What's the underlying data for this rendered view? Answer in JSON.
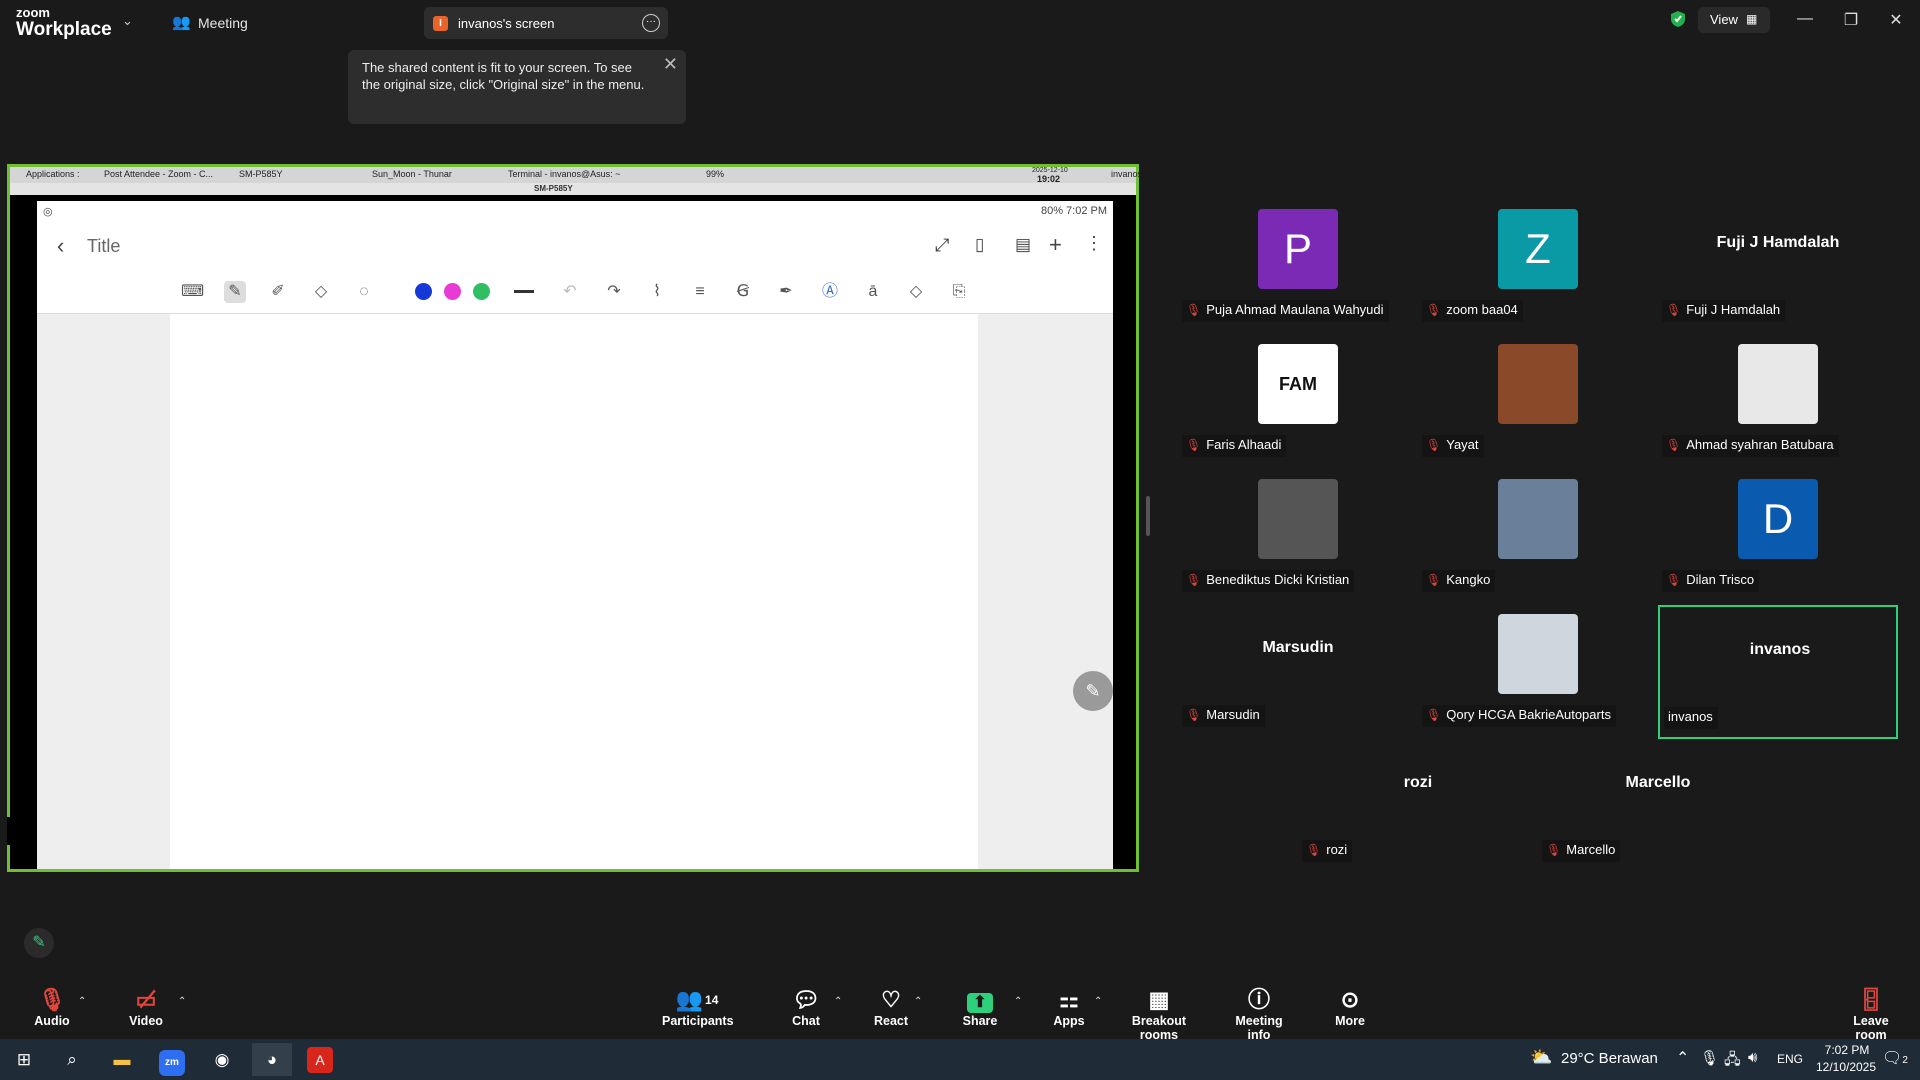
{
  "titlebar": {
    "logo_small": "zoom",
    "logo_big": "Workplace",
    "meeting_label": "Meeting",
    "share_tab_initial": "I",
    "share_tab_label": "invanos's screen",
    "view_label": "View"
  },
  "tooltip": {
    "text": "The shared content is fit to your screen. To see the original size, click \"Original size\" in the menu."
  },
  "shared": {
    "taskbar": [
      "Applications :",
      "Post Attendee - Zoom - C...",
      "SM-P585Y",
      "Sun_Moon - Thunar",
      "Terminal - invanos@Asus: ~"
    ],
    "battery_pct": "99%",
    "date": "2025-12-10",
    "time": "19:02",
    "user": "invanos",
    "window_title": "SM-P585Y",
    "phone_status": "80%  7:02 PM",
    "note_title": "Title",
    "colors": [
      "#1539d6",
      "#e83bd6",
      "#2fbf62"
    ]
  },
  "participants": [
    {
      "name": "Puja Ahmad Maulana Wahyudi",
      "avatar": "P",
      "color": "#7b2ab5"
    },
    {
      "name": "zoom baa04",
      "avatar": "Z",
      "color": "#0a9aa6"
    },
    {
      "name": "Fuji J Hamdalah",
      "big": "Fuji J Hamdalah"
    },
    {
      "name": "Faris Alhaadi",
      "avatar": "FAM",
      "color": "#ffffff"
    },
    {
      "name": "Yayat",
      "avatar": "photo",
      "color": "#8a4a2a"
    },
    {
      "name": "Ahmad syahran Batubara",
      "avatar": "photo",
      "color": "#e8e8e8"
    },
    {
      "name": "Benediktus Dicki Kristian",
      "avatar": "photo",
      "color": "#555555"
    },
    {
      "name": "Kangko",
      "avatar": "photo",
      "color": "#6a7f9a"
    },
    {
      "name": "Dilan Trisco",
      "avatar": "D",
      "color": "#0a5bb0"
    },
    {
      "name": "Marsudin",
      "big": "Marsudin"
    },
    {
      "name": "Qory HCGA BakrieAutoparts",
      "avatar": "photo",
      "color": "#cfd6de"
    },
    {
      "name": "invanos",
      "big": "invanos"
    },
    {
      "name": "rozi",
      "big": "rozi"
    },
    {
      "name": "Marcello",
      "big": "Marcello"
    }
  ],
  "toolbar": {
    "audio": "Audio",
    "video": "Video",
    "participants": "Participants",
    "participants_count": "14",
    "chat": "Chat",
    "react": "React",
    "share": "Share",
    "apps": "Apps",
    "breakout": "Breakout rooms",
    "meeting_info": "Meeting info",
    "more": "More",
    "leave": "Leave room"
  },
  "wintaskbar": {
    "weather": "29°C  Berawan",
    "lang": "ENG",
    "time": "7:02 PM",
    "date": "12/10/2025",
    "notif": "2"
  }
}
